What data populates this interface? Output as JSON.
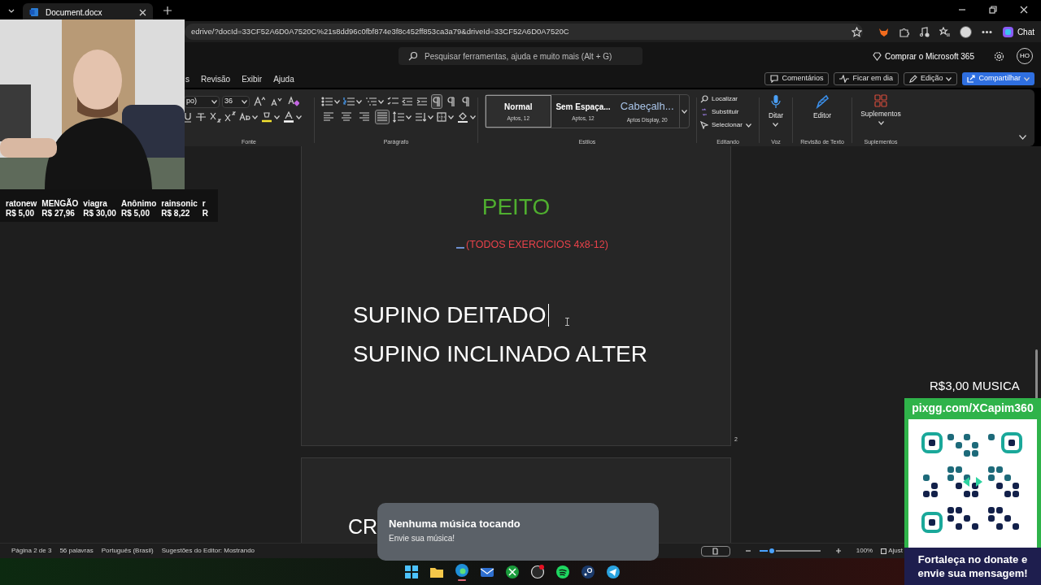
{
  "browser": {
    "tab_title": "Document.docx",
    "address": "edrive/?docId=33CF52A6D0A7520C%21s8dd96c0fbf874e3f8c452ff853ca3a79&driveId=33CF52A6D0A7520C",
    "chat_label": "Chat"
  },
  "word": {
    "search_placeholder": "Pesquisar ferramentas, ajuda e muito mais (Alt + G)",
    "buy_label": "Comprar o Microsoft 365",
    "avatar": "HO",
    "menu": [
      {
        "label": "s"
      },
      {
        "label": "Revisão"
      },
      {
        "label": "Exibir"
      },
      {
        "label": "Ajuda"
      }
    ],
    "actions": [
      {
        "label": "Comentários",
        "kind": "comment"
      },
      {
        "label": "Ficar em dia",
        "kind": "activity"
      },
      {
        "label": "Edição",
        "kind": "edit"
      },
      {
        "label": "Compartilhar",
        "kind": "share"
      }
    ],
    "ribbon": {
      "font_name": "po)",
      "font_size": "36",
      "styles": [
        {
          "name": "Normal",
          "detail": "Aptos, 12",
          "selected": true
        },
        {
          "name": "Sem Espaça...",
          "detail": "Aptos, 12",
          "selected": false
        },
        {
          "name": "Cabeçalh...",
          "detail": "Aptos Display, 20",
          "selected": false
        }
      ],
      "editing": [
        {
          "label": "Localizar",
          "kind": "find"
        },
        {
          "label": "Substituir",
          "kind": "replace"
        },
        {
          "label": "Selecionar",
          "kind": "select"
        }
      ],
      "large": [
        {
          "label": "Ditar",
          "kind": "mic"
        },
        {
          "label": "Editor",
          "kind": "pen"
        },
        {
          "label": "Suplementos",
          "kind": "addins"
        }
      ],
      "group_labels": {
        "font": "Fonte",
        "paragraph": "Parágrafo",
        "styles": "Estilos",
        "editing": "Editando",
        "voice": "Voz",
        "proofing": "Revisão de Texto",
        "addins": "Suplementos"
      }
    }
  },
  "document": {
    "pages": [
      {
        "lines": [
          {
            "text": "PEITO",
            "kind": "title"
          },
          {
            "text": "(TODOS EXERCICIOS 4x8-12)",
            "kind": "subtitle"
          },
          {
            "text": "SUPINO DEITADO",
            "kind": "body"
          },
          {
            "text": "SUPINO INCLINADO ALTER",
            "kind": "body"
          }
        ],
        "number": "2"
      },
      {
        "lines": [
          {
            "text": "CR",
            "kind": "body"
          }
        ]
      }
    ]
  },
  "status_bar": {
    "items": [
      "Página 2 de 3",
      "56 palavras",
      "Português (Brasil)",
      "Sugestões do Editor: Mostrando"
    ],
    "zoom": {
      "level": 0.21,
      "reading": "100%"
    },
    "fit_label": "Ajust"
  },
  "stream": {
    "donors": [
      {
        "name": "ratonew",
        "amount": "R$ 5,00"
      },
      {
        "name": "MENGÃO",
        "amount": "R$ 27,96"
      },
      {
        "name": "viagra",
        "amount": "R$ 30,00"
      },
      {
        "name": "Anônimo",
        "amount": "R$ 5,00"
      },
      {
        "name": "rainsonic",
        "amount": "R$ 8,22"
      },
      {
        "name": "r",
        "amount": "R"
      }
    ],
    "music_price": "R$3,00 MUSICA",
    "pix_url": "pixgg.com/XCapim360",
    "pix_message": "Fortaleça no donate e envie sua mensagem!",
    "toast": {
      "title": "Nenhuma música tocando",
      "subtitle": "Envie sua música!"
    }
  }
}
